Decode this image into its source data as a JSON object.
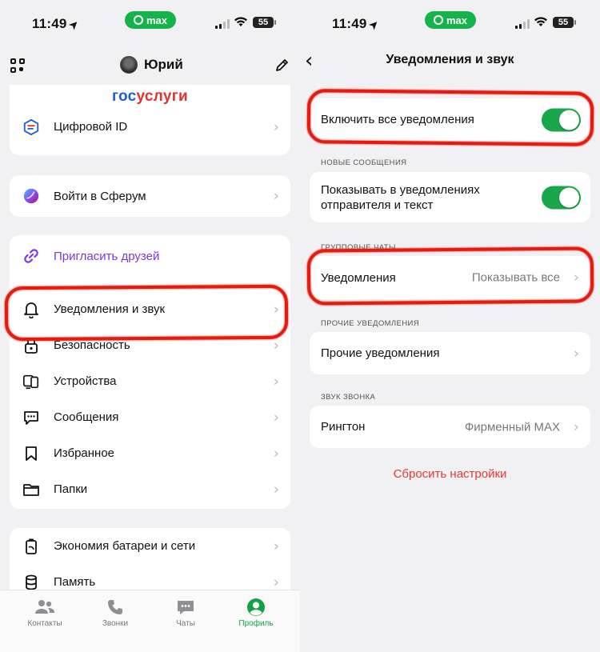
{
  "status": {
    "time": "11:49",
    "pill": "max",
    "battery": "55"
  },
  "profile": {
    "user_name": "Юрий",
    "gosuslugi_logo": {
      "part1": "гос",
      "part2": "услуги"
    },
    "items": {
      "digital_id": "Цифровой ID",
      "sferum": "Войти в Сферум",
      "invite": "Пригласить друзей",
      "notifications": "Уведомления и звук",
      "security": "Безопасность",
      "devices": "Устройства",
      "messages": "Сообщения",
      "favorites": "Избранное",
      "folders": "Папки",
      "battery": "Экономия батареи и сети",
      "memory": "Память"
    },
    "tabs": {
      "contacts": "Контакты",
      "calls": "Звонки",
      "chats": "Чаты",
      "profile": "Профиль"
    }
  },
  "notif": {
    "title": "Уведомления и звук",
    "enable_all": "Включить все уведомления",
    "section_new": "НОВЫЕ СООБЩЕНИЯ",
    "show_sender": "Показывать в уведомлениях отправителя и текст",
    "section_groups": "ГРУППОВЫЕ ЧАТЫ",
    "group_notif_label": "Уведомления",
    "group_notif_value": "Показывать все",
    "section_other": "ПРОЧИЕ УВЕДОМЛЕНИЯ",
    "other_notif": "Прочие уведомления",
    "section_ring": "ЗВУК ЗВОНКА",
    "ringtone_label": "Рингтон",
    "ringtone_value": "Фирменный MAX",
    "reset": "Сбросить настройки",
    "toggles": {
      "enable_all": true,
      "show_sender": true
    }
  },
  "colors": {
    "accent_green": "#1aa64a",
    "highlight_red": "#e31b10",
    "link_purple": "#7a37e8",
    "reset_red": "#e53935"
  }
}
